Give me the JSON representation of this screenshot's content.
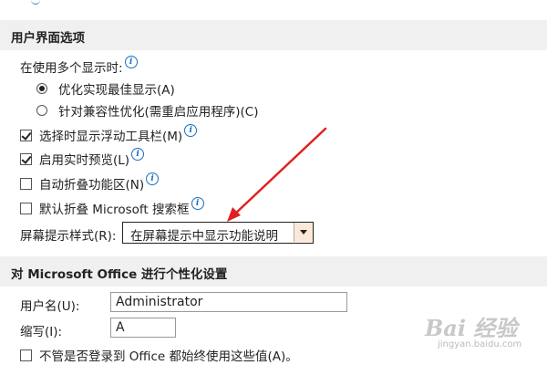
{
  "section_ui": {
    "title": "用户界面选项"
  },
  "multi_display": {
    "label": "在使用多个显示时:",
    "options": [
      {
        "label": "优化实现最佳显示(A)",
        "selected": true
      },
      {
        "label": "针对兼容性优化(需重启应用程序)(C)",
        "selected": false
      }
    ]
  },
  "checkboxes": [
    {
      "label": "选择时显示浮动工具栏(M)",
      "checked": true,
      "info": true
    },
    {
      "label": "启用实时预览(L)",
      "checked": true,
      "info": true
    },
    {
      "label": "自动折叠功能区(N)",
      "checked": false,
      "info": true
    },
    {
      "label": "默认折叠 Microsoft 搜索框",
      "checked": false,
      "info": true
    }
  ],
  "screentip": {
    "label": "屏幕提示样式(R):",
    "value": "在屏幕提示中显示功能说明"
  },
  "section_personal": {
    "title": "对 Microsoft Office 进行个性化设置"
  },
  "username": {
    "label": "用户名(U):",
    "value": "Administrator"
  },
  "initials": {
    "label": "缩写(I):",
    "value": "A"
  },
  "always_use": {
    "label": "不管是否登录到 Office 都始终使用这些值(A)。",
    "checked": false
  },
  "info_glyph": "i",
  "watermark": {
    "main": "Bai 经验",
    "sub": "jingyan.baidu.com"
  },
  "colors": {
    "arrow": "#e02020",
    "info": "#1a6fc0",
    "header_bg": "#f0f0f0"
  }
}
